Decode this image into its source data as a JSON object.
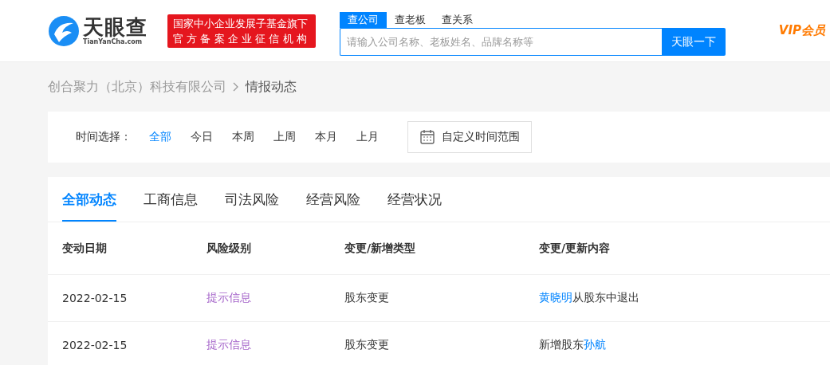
{
  "header": {
    "logo": {
      "name": "天眼查",
      "domain": "TianYanCha.com"
    },
    "badge_lines": [
      "国家中小企业发展子基金旗下",
      "官方备案企业征信机构"
    ],
    "search_tabs": [
      {
        "label": "查公司",
        "selected": true
      },
      {
        "label": "查老板",
        "selected": false
      },
      {
        "label": "查关系",
        "selected": false
      }
    ],
    "search": {
      "placeholder": "请输入公司名称、老板姓名、品牌名称等",
      "button": "天眼一下"
    },
    "vip": "VIP会员"
  },
  "breadcrumb": [
    "创合聚力（北京）科技有限公司",
    "情报动态"
  ],
  "time_filter": {
    "label": "时间选择：",
    "options": [
      {
        "label": "全部",
        "selected": true
      },
      {
        "label": "今日",
        "selected": false
      },
      {
        "label": "本周",
        "selected": false
      },
      {
        "label": "上周",
        "selected": false
      },
      {
        "label": "本月",
        "selected": false
      },
      {
        "label": "上月",
        "selected": false
      }
    ],
    "custom_range": "自定义时间范围"
  },
  "tabs": [
    {
      "label": "全部动态",
      "selected": true
    },
    {
      "label": "工商信息",
      "selected": false
    },
    {
      "label": "司法风险",
      "selected": false
    },
    {
      "label": "经营风险",
      "selected": false
    },
    {
      "label": "经营状况",
      "selected": false
    }
  ],
  "table": {
    "columns": [
      "变动日期",
      "风险级别",
      "变更/新增类型",
      "变更/更新内容"
    ],
    "rows": [
      {
        "date": "2022-02-15",
        "risk": {
          "text": "提示信息",
          "color": "#a463c9"
        },
        "type": "股东变更",
        "content": [
          {
            "kind": "link",
            "text": "黄晓明"
          },
          {
            "kind": "text",
            "text": "从股东中退出"
          }
        ]
      },
      {
        "date": "2022-02-15",
        "risk": {
          "text": "提示信息",
          "color": "#a463c9"
        },
        "type": "股东变更",
        "content": [
          {
            "kind": "text",
            "text": "新增股东"
          },
          {
            "kind": "link",
            "text": "孙航"
          }
        ]
      }
    ]
  }
}
